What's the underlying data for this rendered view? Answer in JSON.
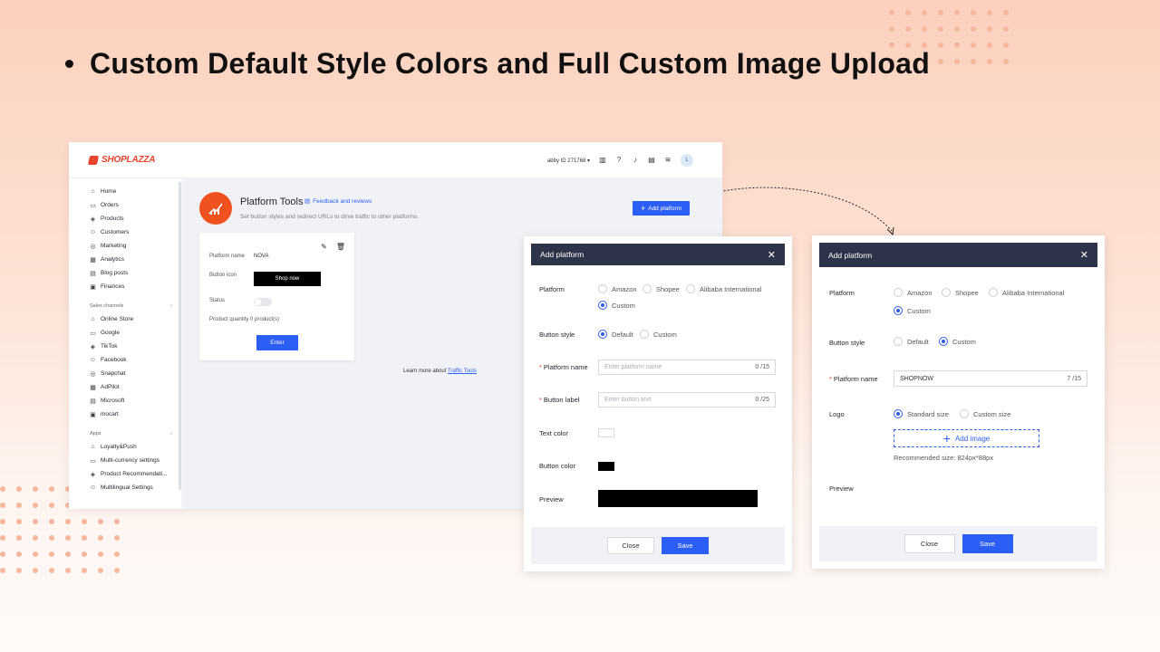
{
  "headline": "Custom Default Style Colors and Full Custom Image Upload",
  "colors": {
    "accent": "#2b5ef5",
    "brand": "#e8432c",
    "modal_header": "#2d3349",
    "icon_orange": "#f0521f"
  },
  "admin": {
    "logo": "SHOPLAZZA",
    "account": "abby ID 271768",
    "avatar_letter": "L",
    "nav": [
      "Home",
      "Orders",
      "Products",
      "Customers",
      "Marketing",
      "Analytics",
      "Blog posts",
      "Finances"
    ],
    "nav_icons": [
      "home-icon",
      "orders-icon",
      "products-icon",
      "customers-icon",
      "marketing-icon",
      "analytics-icon",
      "blog-icon",
      "finances-icon"
    ],
    "sales_channels_label": "Sales channels",
    "channels": [
      "Online Store",
      "Google",
      "TikTok",
      "Facebook",
      "Snapchat",
      "AdPilot",
      "Microsoft",
      "mocart"
    ],
    "apps_label": "Apps",
    "apps": [
      "Loyalty&Push",
      "Multi-currency settings",
      "Product Recommendati...",
      "Multilingual Settings"
    ],
    "page_title": "Platform Tools",
    "feedback": "Feedback and reviews",
    "subtitle": "Set button styles and redirect URLs to drive traffic to other platforms.",
    "add_platform": "Add platform",
    "card": {
      "platform_name_label": "Platform name",
      "platform_name": "NOVA",
      "button_icon_label": "Button icon",
      "shop_now": "Shop now",
      "status_label": "Status",
      "quantity": "Product quantity 0 product(s)",
      "enter": "Enter"
    },
    "learn_more": "Learn more about",
    "learn_more_link": "Traffic Tools"
  },
  "modal_default": {
    "title": "Add platform",
    "platform_label": "Platform",
    "platforms": [
      "Amazon",
      "Shopee",
      "Alibaba International",
      "Custom"
    ],
    "button_style_label": "Button style",
    "styles": [
      "Default",
      "Custom"
    ],
    "platform_name_label": "Platform name",
    "platform_name_placeholder": "Enter platform name",
    "platform_name_count": "0 /15",
    "button_label_label": "Button label",
    "button_label_placeholder": "Enter button text",
    "button_label_count": "0 /25",
    "text_color_label": "Text color",
    "button_color_label": "Button color",
    "preview_label": "Preview",
    "close": "Close",
    "save": "Save"
  },
  "modal_custom": {
    "title": "Add platform",
    "platform_label": "Platform",
    "platforms": [
      "Amazon",
      "Shopee",
      "Alibaba International",
      "Custom"
    ],
    "button_style_label": "Button style",
    "styles": [
      "Default",
      "Custom"
    ],
    "platform_name_label": "Platform name",
    "platform_name_value": "SHOPNOW",
    "platform_name_count": "7 /15",
    "logo_label": "Logo",
    "sizes": [
      "Standard size",
      "Custom size"
    ],
    "add_image": "Add image",
    "recommended": "Recommended size: 824px*88px",
    "preview_label": "Preview",
    "close": "Close",
    "save": "Save"
  }
}
